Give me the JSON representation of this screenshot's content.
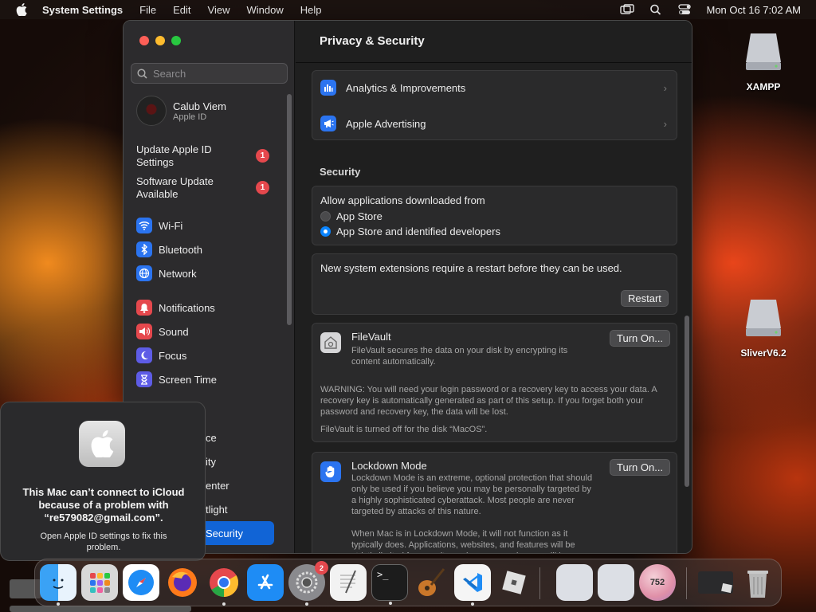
{
  "menubar": {
    "app_name": "System Settings",
    "items": [
      "File",
      "Edit",
      "View",
      "Window",
      "Help"
    ],
    "clock": "Mon Oct 16  7:02 AM",
    "icons": [
      "screen-mirroring-icon",
      "spotlight-search-icon",
      "control-center-icon"
    ]
  },
  "sidebar": {
    "search_placeholder": "Search",
    "account": {
      "name": "Calub Viem",
      "sub": "Apple ID"
    },
    "notices": [
      {
        "label": "Update Apple ID Settings",
        "badge": "1"
      },
      {
        "label": "Software Update Available",
        "badge": "1"
      }
    ],
    "items": [
      {
        "label": "Wi-Fi",
        "icon": "wifi-icon",
        "color": "#2b74f0"
      },
      {
        "label": "Bluetooth",
        "icon": "bluetooth-icon",
        "color": "#2b74f0"
      },
      {
        "label": "Network",
        "icon": "globe-icon",
        "color": "#2b74f0"
      },
      {
        "label": "Notifications",
        "icon": "bell-icon",
        "color": "#e5484d"
      },
      {
        "label": "Sound",
        "icon": "speaker-icon",
        "color": "#e5484d"
      },
      {
        "label": "Focus",
        "icon": "moon-icon",
        "color": "#5e5ce6"
      },
      {
        "label": "Screen Time",
        "icon": "hourglass-icon",
        "color": "#5e5ce6"
      }
    ],
    "partial_items": [
      "ce",
      "ity",
      "enter",
      "tlight"
    ],
    "selected": "Security"
  },
  "content": {
    "title": "Privacy & Security",
    "rows": [
      {
        "label": "Analytics & Improvements",
        "icon": "bar-chart-icon"
      },
      {
        "label": "Apple Advertising",
        "icon": "megaphone-icon"
      }
    ],
    "security_title": "Security",
    "allow_label": "Allow applications downloaded from",
    "options": [
      {
        "label": "App Store",
        "selected": false
      },
      {
        "label": "App Store and identified developers",
        "selected": true
      }
    ],
    "extensions_text": "New system extensions require a restart before they can be used.",
    "restart_label": "Restart",
    "filevault": {
      "title": "FileVault",
      "desc": "FileVault secures the data on your disk by encrypting its content automatically.",
      "button": "Turn On...",
      "warning": "WARNING: You will need your login password or a recovery key to access your data. A recovery key is automatically generated as part of this setup. If you forget both your password and recovery key, the data will be lost.",
      "status": "FileVault is turned off for the disk “MacOS”."
    },
    "lockdown": {
      "title": "Lockdown Mode",
      "desc": "Lockdown Mode is an extreme, optional protection that should only be used if you believe you may be personally targeted by a highly sophisticated cyberattack. Most people are never targeted by attacks of this nature.",
      "button": "Turn On...",
      "desc2": "When Mac is in Lockdown Mode, it will not function as it typically does. Applications, websites, and features will be strictly limited for security, and some experiences will be"
    }
  },
  "popup": {
    "title": "This Mac can’t connect to iCloud because of a problem with “re579082@gmail.com”.",
    "message": "Open Apple ID settings to fix this problem."
  },
  "desktop": [
    {
      "label": "XAMPP"
    },
    {
      "label": "SliverV6.2"
    }
  ],
  "dock": {
    "apps": [
      {
        "name": "finder-icon",
        "color": "#2f8ff0"
      },
      {
        "name": "launchpad-icon",
        "color": "#d8d8d8"
      },
      {
        "name": "safari-icon",
        "color": "#ffffff"
      },
      {
        "name": "firefox-icon",
        "color": "#ff7a1a"
      },
      {
        "name": "chrome-icon",
        "color": "#ffffff"
      },
      {
        "name": "app-store-icon",
        "color": "#1e8cf5"
      },
      {
        "name": "system-settings-icon",
        "color": "#8a8a8e"
      },
      {
        "name": "textedit-icon",
        "color": "#f2f2f2"
      },
      {
        "name": "terminal-icon",
        "color": "#1c1c1c"
      },
      {
        "name": "guitar-icon",
        "color": "#3a2a1a"
      },
      {
        "name": "vscode-icon",
        "color": "#f5f5f5"
      },
      {
        "name": "roblox-icon",
        "color": "#d0d0d0"
      },
      {
        "name": "blank-app-icon",
        "color": "#dcdfe5"
      },
      {
        "name": "blank-app-icon",
        "color": "#dcdfe5"
      },
      {
        "name": "counter-app-icon",
        "color": "#f0a0b0"
      }
    ],
    "settings_badge": "2",
    "counter_value": "752"
  }
}
